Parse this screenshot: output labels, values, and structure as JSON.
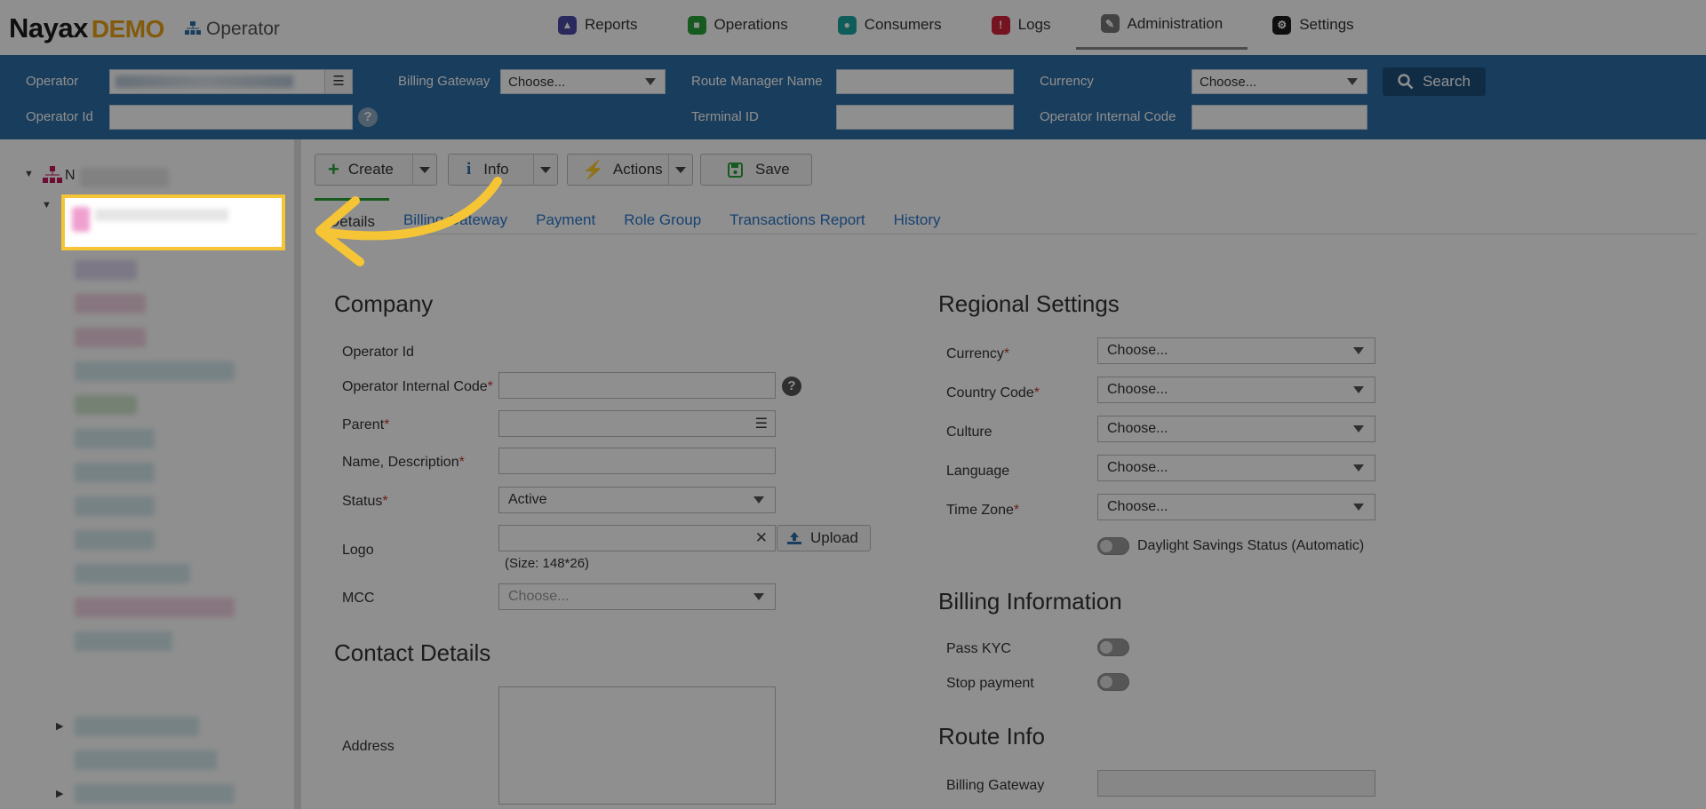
{
  "header": {
    "brand_name": "Nayax",
    "brand_demo": "DEMO",
    "brand_section": "Operator",
    "nav": [
      {
        "label": "Reports",
        "icon": "reports-icon",
        "color": "#4a4aa8"
      },
      {
        "label": "Operations",
        "icon": "operations-icon",
        "color": "#2aa13a"
      },
      {
        "label": "Consumers",
        "icon": "consumers-icon",
        "color": "#1ba7a3"
      },
      {
        "label": "Logs",
        "icon": "logs-icon",
        "color": "#d0223a"
      },
      {
        "label": "Administration",
        "icon": "administration-icon",
        "color": "#777777"
      },
      {
        "label": "Settings",
        "icon": "settings-icon",
        "color": "#1b1b1b"
      }
    ],
    "active_nav": "Administration"
  },
  "search": {
    "operator_label": "Operator",
    "operator_id_label": "Operator Id",
    "billing_gateway_label": "Billing Gateway",
    "billing_gateway_value": "Choose...",
    "route_manager_label": "Route Manager Name",
    "terminal_id_label": "Terminal ID",
    "currency_label": "Currency",
    "currency_value": "Choose...",
    "operator_internal_code_label": "Operator Internal Code",
    "search_button": "Search"
  },
  "toolbar": {
    "create": "Create",
    "info": "Info",
    "actions": "Actions",
    "save": "Save"
  },
  "tabs": [
    "Details",
    "Billing Gateway",
    "Payment",
    "Role Group",
    "Transactions Report",
    "History"
  ],
  "company": {
    "title": "Company",
    "operator_id": "Operator Id",
    "operator_internal_code": "Operator Internal Code",
    "parent": "Parent",
    "name_description": "Name, Description",
    "status": "Status",
    "status_value": "Active",
    "logo": "Logo",
    "upload": "Upload",
    "logo_size": "(Size: 148*26)",
    "mcc": "MCC",
    "mcc_placeholder": "Choose..."
  },
  "contact": {
    "title": "Contact Details",
    "address": "Address"
  },
  "regional": {
    "title": "Regional Settings",
    "currency": "Currency",
    "country_code": "Country Code",
    "culture": "Culture",
    "language": "Language",
    "time_zone": "Time Zone",
    "choose": "Choose...",
    "dst": "Daylight Savings Status (Automatic)"
  },
  "billing": {
    "title": "Billing Information",
    "pass_kyc": "Pass KYC",
    "stop_payment": "Stop payment"
  },
  "route": {
    "title": "Route Info",
    "billing_gateway": "Billing Gateway"
  },
  "tree": {
    "root_label": "N"
  }
}
